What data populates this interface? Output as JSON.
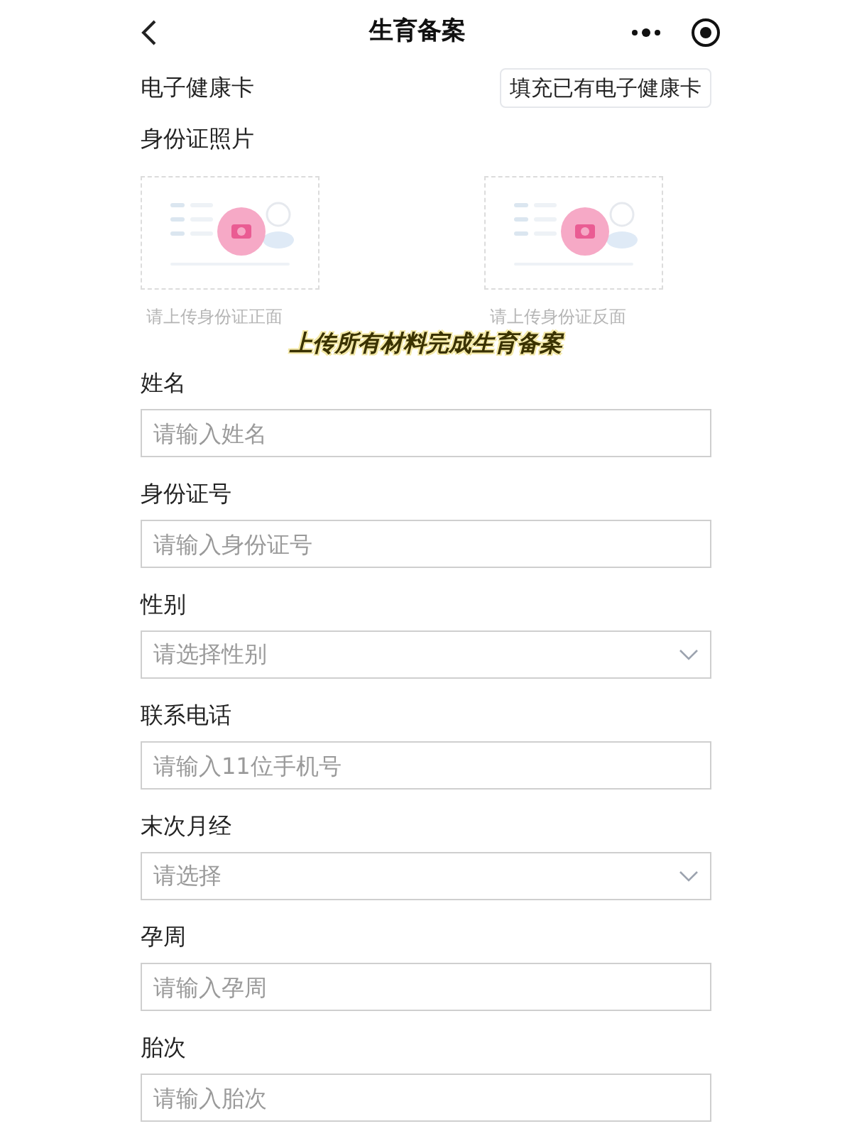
{
  "header": {
    "title": "生育备案"
  },
  "health_card": {
    "label": "电子健康卡",
    "button": "填充已有电子健康卡"
  },
  "id_photos": {
    "label": "身份证照片",
    "uploads": [
      {
        "hint": "请上传身份证正面"
      },
      {
        "hint": "请上传身份证反面"
      }
    ]
  },
  "caption": "上传所有材料完成生育备案",
  "fields": [
    {
      "label": "姓名",
      "placeholder": "请输入姓名",
      "kind": "text"
    },
    {
      "label": "身份证号",
      "placeholder": "请输入身份证号",
      "kind": "text"
    },
    {
      "label": "性别",
      "placeholder": "请选择性别",
      "kind": "select"
    },
    {
      "label": "联系电话",
      "placeholder": "请输入11位手机号",
      "kind": "text"
    },
    {
      "label": "末次月经",
      "placeholder": "请选择",
      "kind": "select"
    },
    {
      "label": "孕周",
      "placeholder": "请输入孕周",
      "kind": "text"
    },
    {
      "label": "胎次",
      "placeholder": "请输入胎次",
      "kind": "text"
    }
  ]
}
